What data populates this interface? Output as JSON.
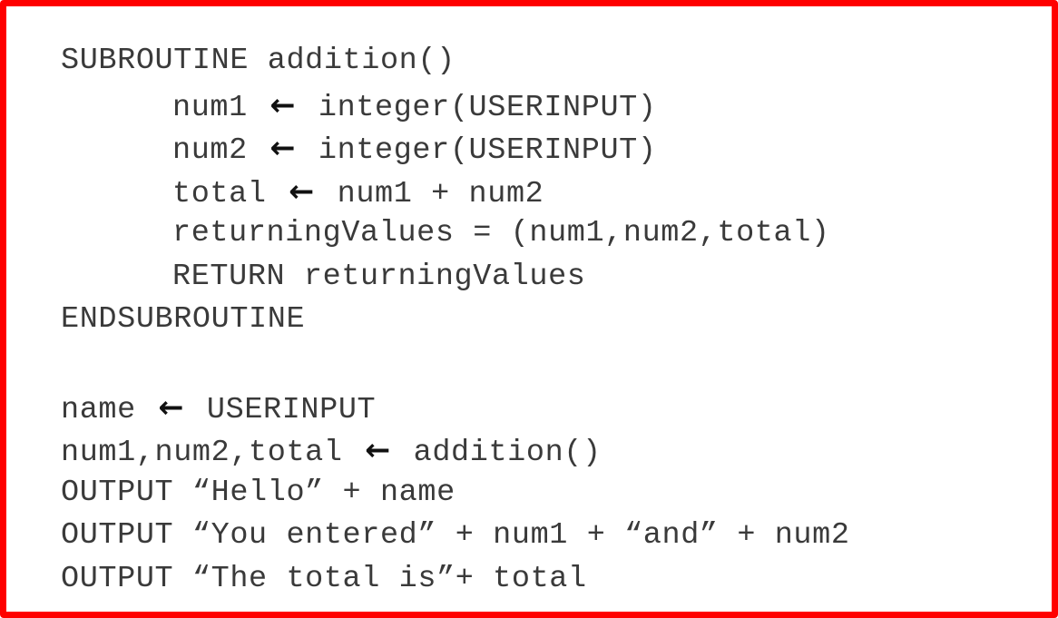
{
  "colors": {
    "border": "#ff0000",
    "background": "#ffffff",
    "text": "#3a3a3a",
    "arrow": "#111111"
  },
  "code": {
    "l1": "SUBROUTINE addition()",
    "l2_a": "num1 ",
    "l2_b": " integer(USERINPUT)",
    "l3_a": "num2 ",
    "l3_b": " integer(USERINPUT)",
    "l4_a": "total ",
    "l4_b": " num1 + num2",
    "l5": "returningValues = (num1,num2,total)",
    "l6": "RETURN returningValues",
    "l7": "ENDSUBROUTINE",
    "l9_a": "name ",
    "l9_b": " USERINPUT",
    "l10_a": "num1,num2,total ",
    "l10_b": " addition()",
    "l11": "OUTPUT “Hello” + name",
    "l12": "OUTPUT “You entered” + num1 + “and” + num2",
    "l13": "OUTPUT “The total is”+ total"
  },
  "icons": {
    "assign": "left-arrow-icon",
    "assign_glyph": "←"
  }
}
